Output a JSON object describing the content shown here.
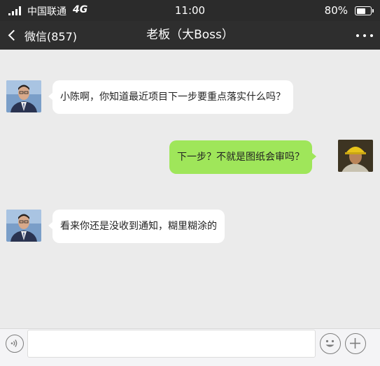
{
  "status_bar": {
    "carrier": "中国联通",
    "network": "4G",
    "time": "11:00",
    "battery_pct": "80%",
    "battery_level": 0.8
  },
  "nav": {
    "back_label": "微信(857)",
    "title": "老板（大Boss）"
  },
  "messages": [
    {
      "side": "left",
      "sender": "boss",
      "text": "小陈啊，你知道最近项目下一步要重点落实什么吗？"
    },
    {
      "side": "right",
      "sender": "worker",
      "text": "下一步？不就是图纸会审吗？"
    },
    {
      "side": "left",
      "sender": "boss",
      "text": "看来你还是没收到通知，糊里糊涂的"
    }
  ],
  "input": {
    "value": "",
    "placeholder": ""
  },
  "colors": {
    "status_bg": "#2b2b2b",
    "nav_bg": "#2e2e2e",
    "chat_bg": "#ebebeb",
    "incoming_bubble": "#ffffff",
    "outgoing_bubble": "#9fe65a"
  },
  "icons": {
    "back": "chevron-left-icon",
    "more": "more-dots-icon",
    "voice": "voice-icon",
    "emoji": "emoji-icon",
    "plus": "plus-icon"
  }
}
